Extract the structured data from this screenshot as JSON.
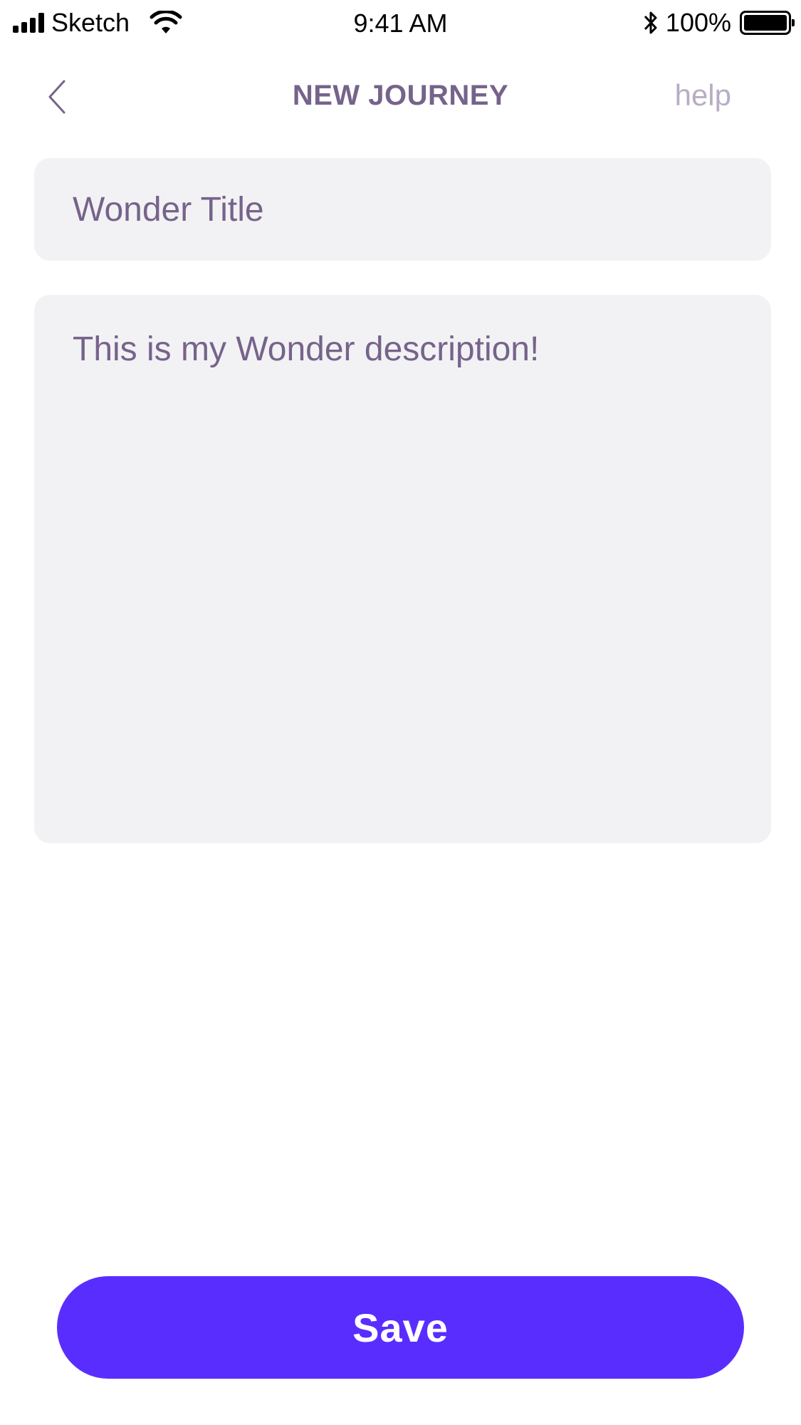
{
  "status_bar": {
    "carrier": "Sketch",
    "time": "9:41 AM",
    "battery_percent": "100%",
    "battery_level": 1.0,
    "signal_icon": "signal-bars-icon",
    "wifi_icon": "wifi-icon",
    "bluetooth_icon": "bluetooth-icon"
  },
  "nav": {
    "back_icon": "chevron-left-icon",
    "title": "NEW JOURNEY",
    "help_label": "help"
  },
  "form": {
    "title_value": "Wonder Title",
    "description_value": "This is my Wonder description!"
  },
  "actions": {
    "save_label": "Save"
  },
  "colors": {
    "accent": "#5a2dff",
    "title_text": "#76638b",
    "help_text": "#b7adc4",
    "field_background": "#f2f2f4"
  }
}
